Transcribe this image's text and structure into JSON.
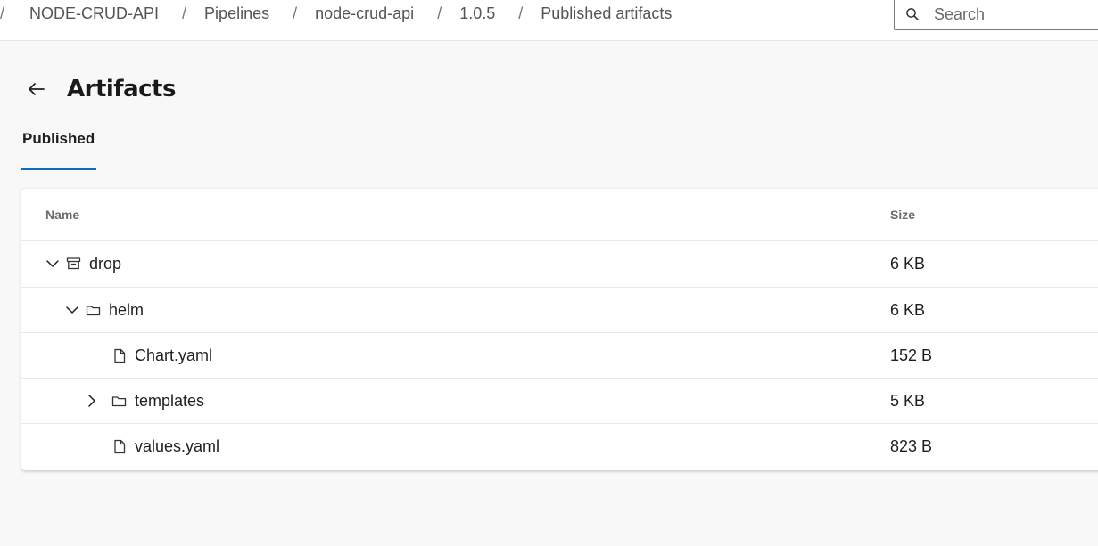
{
  "breadcrumb": {
    "separator": "/",
    "items": [
      "NODE-CRUD-API",
      "Pipelines",
      "node-crud-api",
      "1.0.5",
      "Published artifacts"
    ]
  },
  "search": {
    "placeholder": "Search",
    "value": ""
  },
  "page": {
    "title": "Artifacts",
    "back_icon": "arrow-left-icon"
  },
  "tabs": [
    {
      "label": "Published",
      "selected": true
    }
  ],
  "table": {
    "columns": {
      "name": "Name",
      "size": "Size"
    },
    "rows": [
      {
        "name": "drop",
        "size": "6 KB",
        "icon": "archive-icon",
        "expander": "chevron-down-icon"
      },
      {
        "name": "helm",
        "size": "6 KB",
        "icon": "folder-icon",
        "expander": "chevron-down-icon"
      },
      {
        "name": "Chart.yaml",
        "size": "152 B",
        "icon": "file-icon",
        "expander": ""
      },
      {
        "name": "templates",
        "size": "5 KB",
        "icon": "folder-icon",
        "expander": "chevron-right-icon"
      },
      {
        "name": "values.yaml",
        "size": "823 B",
        "icon": "file-icon",
        "expander": ""
      }
    ]
  },
  "colors": {
    "accent": "#0f6cbd",
    "background": "#f8f8f8"
  }
}
